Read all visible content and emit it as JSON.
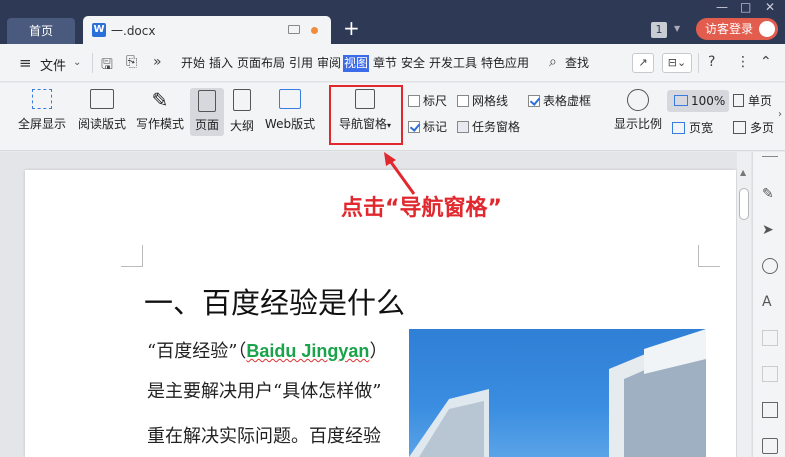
{
  "titlebar": {
    "home_tab": "首页",
    "doc_tab": "一.docx",
    "new_tab": "+",
    "badge": "1",
    "login": "访客登录"
  },
  "menubar": {
    "file": "文件",
    "menus": [
      "开始",
      "插入",
      "页面布局",
      "引用",
      "审阅",
      "视图",
      "章节",
      "安全",
      "开发工具",
      "特色应用"
    ],
    "active_menu": "视图",
    "search": "查找",
    "help": "?"
  },
  "ribbon": {
    "fullscreen": "全屏显示",
    "reading": "阅读版式",
    "writing": "写作模式",
    "page": "页面",
    "outline": "大纲",
    "web": "Web版式",
    "nav_pane": "导航窗格",
    "checks": [
      {
        "label": "标尺",
        "checked": false
      },
      {
        "label": "网格线",
        "checked": false
      },
      {
        "label": "表格虚框",
        "checked": true
      },
      {
        "label": "标记",
        "checked": true
      },
      {
        "label": "任务窗格",
        "checked": false
      }
    ],
    "zoom_label": "显示比例",
    "zoom_pct": "100%",
    "page_width": "页宽",
    "single_page": "单页",
    "multi_page": "多页"
  },
  "document": {
    "annotation": "点击“导航窗格”",
    "heading": "一、百度经验是什么",
    "line1_pre": "“百度经验”（",
    "line1_green": "Baidu Jingyan",
    "line1_post": "）",
    "line2": "是主要解决用户“具体怎样做”",
    "line3": "重在解决实际问题。百度经验"
  },
  "colors": {
    "accent": "#3d6ce8",
    "highlight_red": "#e0282e",
    "login_red": "#e35d4f",
    "titlebar": "#2e3a55"
  }
}
